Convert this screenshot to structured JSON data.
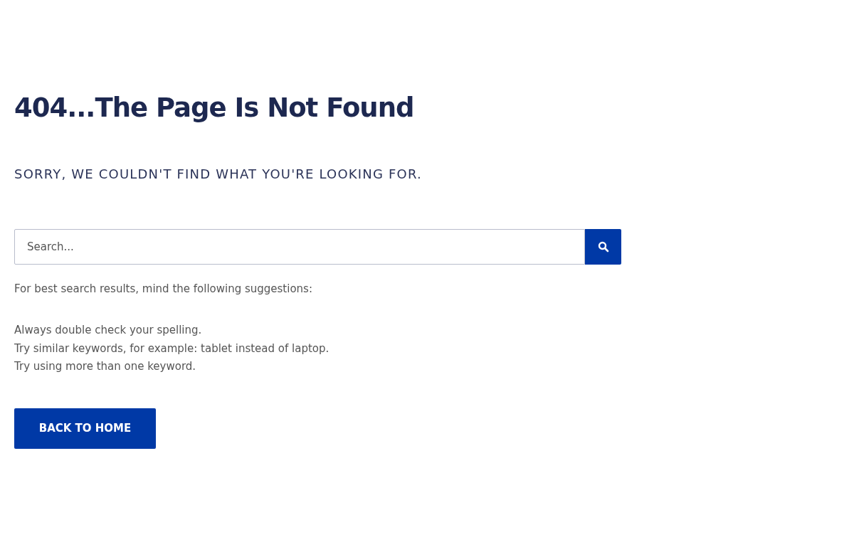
{
  "heading": "404...The Page Is Not Found",
  "subheading": "SORRY, WE COULDN'T FIND WHAT YOU'RE LOOKING FOR.",
  "search": {
    "placeholder": "Search..."
  },
  "hint": "For best search results, mind the following suggestions:",
  "suggestions": [
    "Always double check your spelling.",
    "Try similar keywords, for example: tablet instead of laptop.",
    "Try using more than one keyword."
  ],
  "button": "BACK TO HOME"
}
